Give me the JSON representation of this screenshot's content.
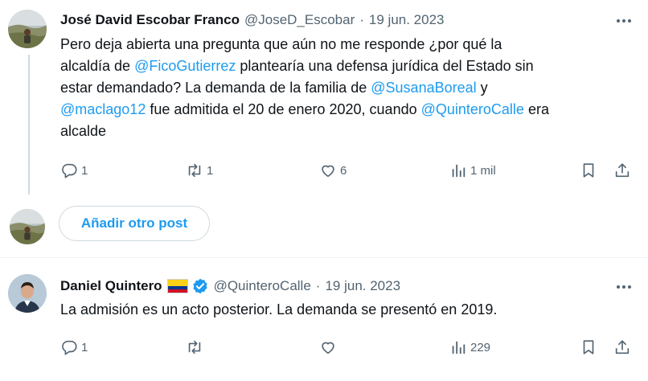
{
  "post1": {
    "author_name": "José David Escobar Franco",
    "handle": "@JoseD_Escobar",
    "separator": "·",
    "date": "19 jun. 2023",
    "text": {
      "line1": "Pero deja abierta una pregunta que aún no me responde ¿por qué la",
      "line2_pre": "alcaldía de ",
      "line2_mention": "@FicoGutierrez",
      "line2_post": " plantearía una defensa jurídica del Estado sin",
      "line3_pre": "estar demandado? La demanda de la familia de ",
      "line3_mention": "@SusanaBoreal",
      "line3_post": " y",
      "line4_mention1": "@maclago12",
      "line4_mid": " fue admitida el 20 de enero 2020, cuando ",
      "line4_mention2": "@QuinteroCalle",
      "line4_post": " era",
      "line5": "alcalde"
    },
    "stats": {
      "replies": "1",
      "reposts": "1",
      "likes": "6",
      "views": "1 mil"
    }
  },
  "reply_composer": {
    "button_label": "Añadir otro post"
  },
  "post2": {
    "author_name": "Daniel Quintero",
    "handle": "@QuinteroCalle",
    "separator": "·",
    "date": "19 jun. 2023",
    "text": "La admisión es un acto posterior. La demanda se presentó en 2019.",
    "stats": {
      "replies": "1",
      "reposts": "",
      "likes": "",
      "views": "229"
    }
  },
  "colors": {
    "accent": "#1d9bf0",
    "muted": "#536471",
    "text": "#0f1419",
    "border": "#cfd9de"
  },
  "icons": {
    "reply": "reply-icon",
    "repost": "repost-icon",
    "like": "heart-icon",
    "views": "analytics-icon",
    "bookmark": "bookmark-icon",
    "share": "share-icon",
    "more": "more-icon",
    "verified": "verified-badge-icon",
    "flag": "colombia-flag-icon"
  }
}
